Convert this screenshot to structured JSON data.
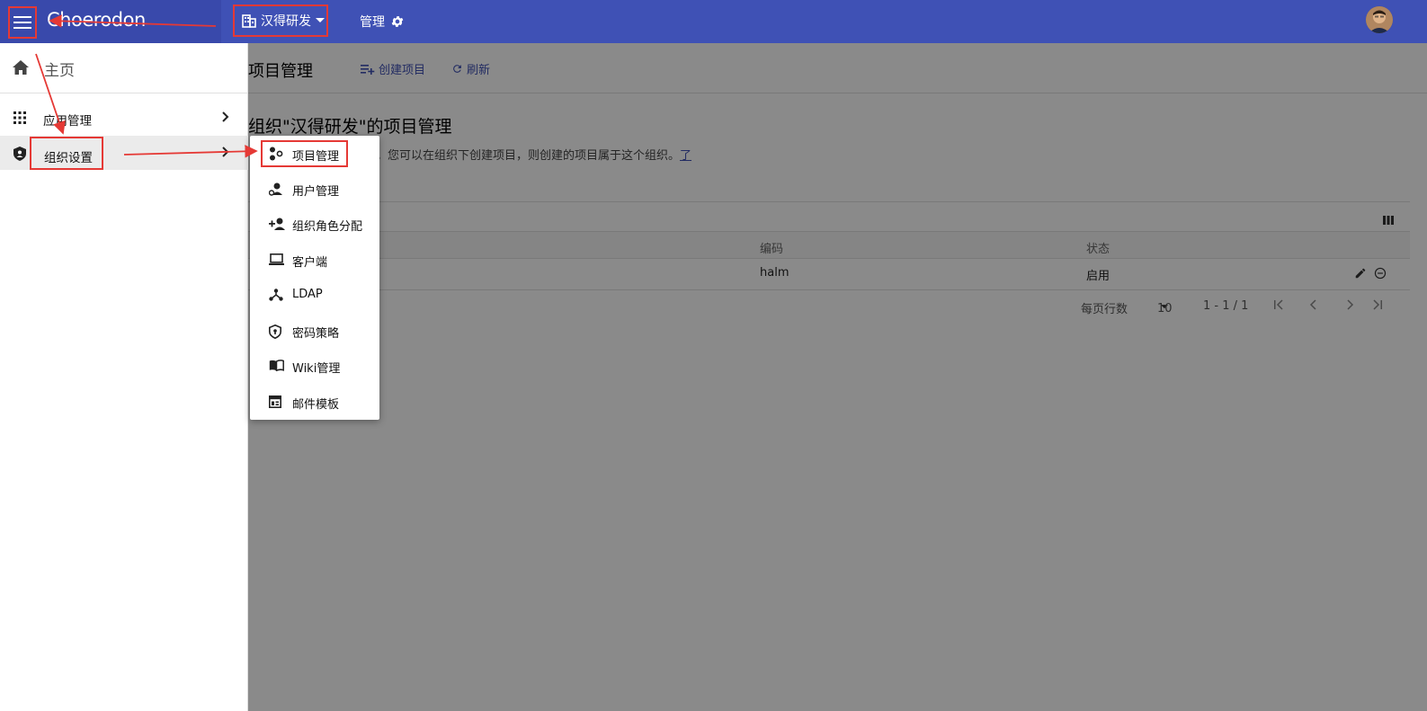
{
  "window": {
    "logo_text": "Choerodon",
    "org_name": "汉得研发",
    "manage_label": "管理"
  },
  "content": {
    "page_title": "项目管理",
    "create_project": "创建项目",
    "refresh": "刷新",
    "section_title": "组织\"汉得研发\"的项目管理",
    "section_desc": "。您可以在组织下创建项目，则创建的项目属于这个组织。",
    "learn_more": "了",
    "table": {
      "columns": [
        "编码",
        "状态"
      ],
      "rows": [
        {
          "code": "halm",
          "status": "启用"
        }
      ]
    },
    "pager": {
      "rows_per_page_label": "每页行数",
      "rows_per_page_value": "10",
      "range": "1 - 1 / 1"
    }
  },
  "sidenav": {
    "home_label": "主页",
    "items": [
      {
        "label": "应用管理",
        "icon": "apps-grid-icon"
      },
      {
        "label": "组织设置",
        "icon": "shield-user-icon"
      }
    ]
  },
  "submenu": {
    "items": [
      {
        "label": "项目管理",
        "icon": "project-icon"
      },
      {
        "label": "用户管理",
        "icon": "user-settings-icon"
      },
      {
        "label": "组织角色分配",
        "icon": "person-add-icon"
      },
      {
        "label": "客户端",
        "icon": "laptop-icon"
      },
      {
        "label": "LDAP",
        "icon": "ldap-network-icon"
      },
      {
        "label": "密码策略",
        "icon": "password-shield-icon"
      },
      {
        "label": "Wiki管理",
        "icon": "book-icon"
      },
      {
        "label": "邮件模板",
        "icon": "mail-template-icon"
      }
    ]
  },
  "colors": {
    "primary": "#3f51b5",
    "primary_dark": "#3949ab",
    "annotation_red": "#e53935"
  }
}
